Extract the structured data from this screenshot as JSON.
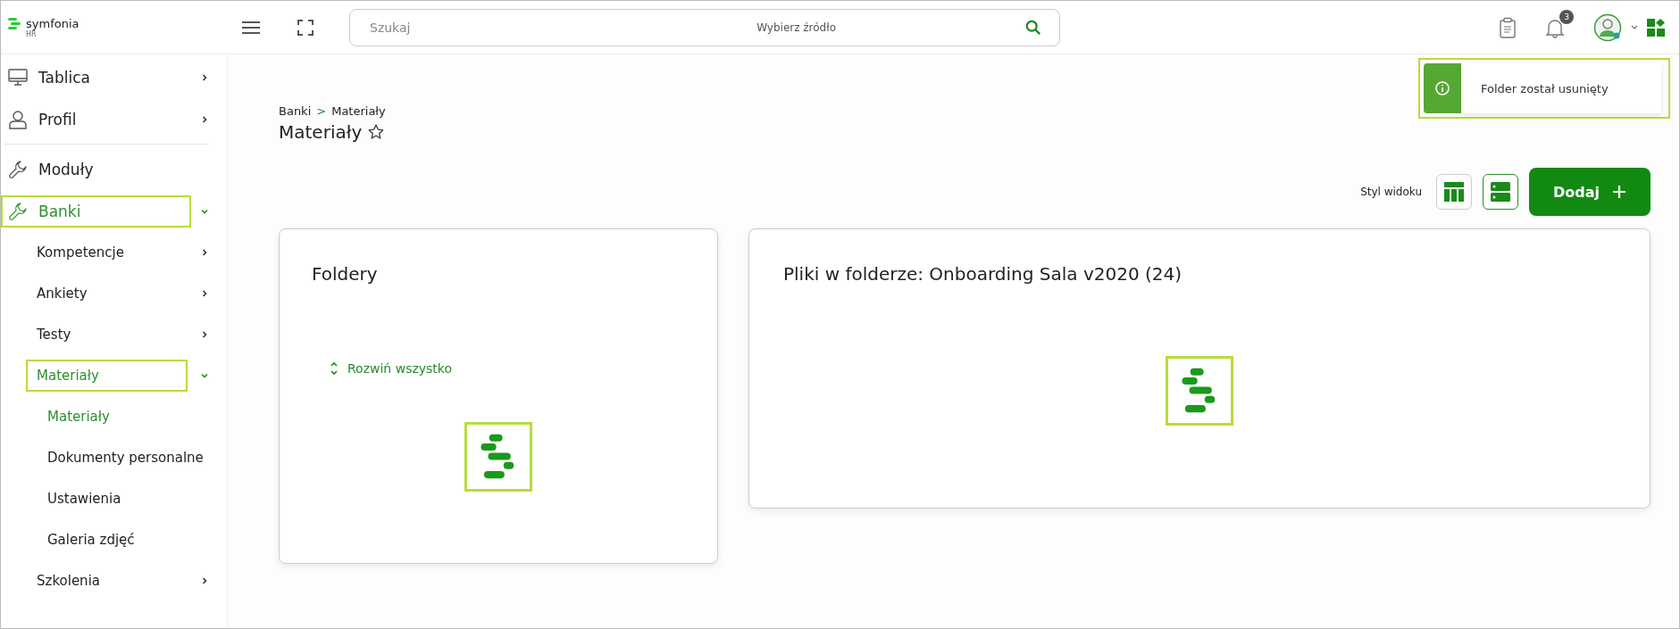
{
  "header": {
    "logo": {
      "name": "symfonia",
      "product": "HR"
    },
    "search": {
      "placeholder": "Szukaj",
      "source": "Wybierz źródło"
    },
    "notifications": {
      "count": "3"
    }
  },
  "sidebar": {
    "groups": [
      [
        {
          "label": "Tablica",
          "kind": "monitor",
          "expanded": false,
          "selected": false,
          "highlighted": false
        },
        {
          "label": "Profil",
          "kind": "person",
          "expanded": false,
          "selected": false,
          "highlighted": false
        }
      ],
      [
        {
          "label": "Moduły",
          "kind": "wrench",
          "selected": false,
          "highlighted": false
        },
        {
          "label": "Banki",
          "kind": "wrench",
          "expanded": true,
          "selected": true,
          "highlighted": true,
          "children": [
            {
              "label": "Kompetencje",
              "expanded": false,
              "selected": false,
              "highlighted": false
            },
            {
              "label": "Ankiety",
              "expanded": false,
              "selected": false,
              "highlighted": false
            },
            {
              "label": "Testy",
              "expanded": false,
              "selected": false,
              "highlighted": false
            },
            {
              "label": "Materiały",
              "expanded": true,
              "selected": true,
              "highlighted": true,
              "children": [
                {
                  "label": "Materiały",
                  "selected": true,
                  "highlighted": false
                },
                {
                  "label": "Dokumenty personalne",
                  "selected": false,
                  "highlighted": false
                },
                {
                  "label": "Ustawienia",
                  "selected": false,
                  "highlighted": false
                },
                {
                  "label": "Galeria zdjęć",
                  "selected": false,
                  "highlighted": false
                }
              ]
            },
            {
              "label": "Szkolenia",
              "expanded": false,
              "selected": false,
              "highlighted": false
            }
          ]
        }
      ]
    ]
  },
  "breadcrumb": {
    "separator": ">",
    "items": [
      {
        "label": "Banki"
      },
      {
        "label": "Materiały"
      }
    ]
  },
  "page": {
    "title": "Materiały",
    "favorite": false
  },
  "toast": {
    "message": "Folder został usunięty",
    "highlighted": true
  },
  "toolbar": {
    "label": "Styl widoku",
    "view_styles": [
      {
        "kind": "columns",
        "selected": false
      },
      {
        "kind": "rows",
        "selected": true
      }
    ],
    "add_button": "Dodaj"
  },
  "cards": [
    {
      "title": "Foldery",
      "expand_all": "Rozwiń wszystko",
      "loading": true,
      "loader_highlighted": true
    },
    {
      "title": "Pliki w folderze: Onboarding Sala v2020 (24)",
      "loading": true,
      "loader_highlighted": true
    }
  ]
}
